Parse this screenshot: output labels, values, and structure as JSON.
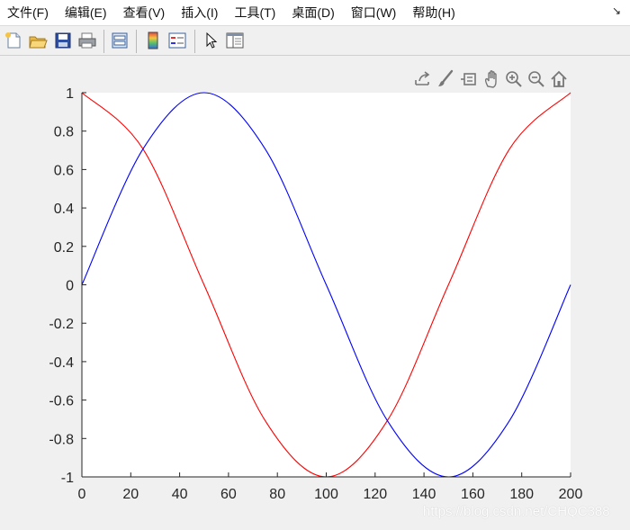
{
  "menu": {
    "items": [
      {
        "label": "文件(F)"
      },
      {
        "label": "编辑(E)"
      },
      {
        "label": "查看(V)"
      },
      {
        "label": "插入(I)"
      },
      {
        "label": "工具(T)"
      },
      {
        "label": "桌面(D)"
      },
      {
        "label": "窗口(W)"
      },
      {
        "label": "帮助(H)"
      }
    ],
    "dock_arrow": "↘"
  },
  "toolbar": {
    "buttons": [
      "new-figure-icon",
      "open-file-icon",
      "save-icon",
      "print-icon",
      "link-plot-icon",
      "insert-colorbar-icon",
      "insert-legend-icon",
      "edit-plot-arrow-icon",
      "property-inspector-icon"
    ]
  },
  "axes_toolbar": {
    "buttons": [
      "export-icon",
      "brush-icon",
      "data-tips-icon",
      "pan-hand-icon",
      "zoom-in-icon",
      "zoom-out-icon",
      "home-icon"
    ]
  },
  "watermark": "https://blog.csdn.net/CHQC388",
  "colors": {
    "series_red": "#ff0000",
    "series_blue": "#0000ff",
    "axes_bg": "#ffffff",
    "figure_bg": "#f0f0f0"
  },
  "chart_data": {
    "type": "line",
    "title": "",
    "xlabel": "",
    "ylabel": "",
    "xlim": [
      0,
      200
    ],
    "ylim": [
      -1,
      1
    ],
    "xticks": [
      "0",
      "20",
      "40",
      "60",
      "80",
      "100",
      "120",
      "140",
      "160",
      "180",
      "200"
    ],
    "yticks": [
      "-1",
      "-0.8",
      "-0.6",
      "-0.4",
      "-0.2",
      "0",
      "0.2",
      "0.4",
      "0.6",
      "0.8",
      "1"
    ],
    "grid": false,
    "legend": "none",
    "series": [
      {
        "color": "#ff0000",
        "x": [
          0,
          25,
          50,
          75,
          100,
          125,
          150,
          175,
          200
        ],
        "y": [
          1.0,
          0.707,
          0.0,
          -0.707,
          -1.0,
          -0.707,
          0.0,
          0.707,
          1.0
        ]
      },
      {
        "color": "#0000ff",
        "x": [
          0,
          25,
          50,
          75,
          100,
          125,
          150,
          175,
          200
        ],
        "y": [
          0.0,
          0.707,
          1.0,
          0.707,
          0.0,
          -0.707,
          -1.0,
          -0.707,
          0.0
        ]
      }
    ]
  }
}
